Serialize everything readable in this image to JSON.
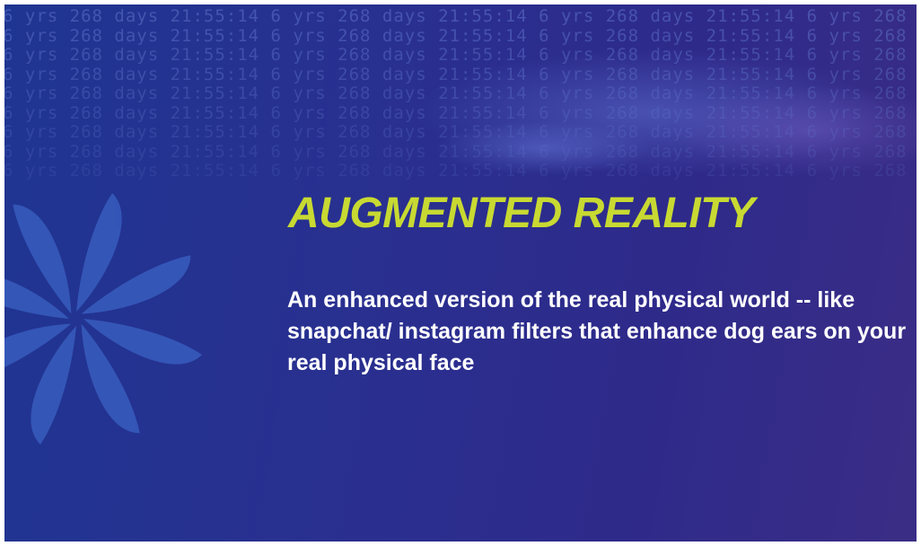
{
  "slide": {
    "title": "AUGMENTED REALITY",
    "body": "An enhanced version of the real physical world -- like snapchat/ instagram filters that enhance dog ears on your real physical face"
  },
  "background": {
    "ticker_text": "6 yrs 268 days 21:55:14",
    "ticker_rows": 9
  },
  "colors": {
    "background": "#2a2f8f",
    "title": "#c8d932",
    "body": "#ffffff",
    "ticker": "#5f73c9",
    "swirl": "#3a62c4"
  },
  "decorations": {
    "swirl_icon": "pinwheel-swirl-icon"
  }
}
